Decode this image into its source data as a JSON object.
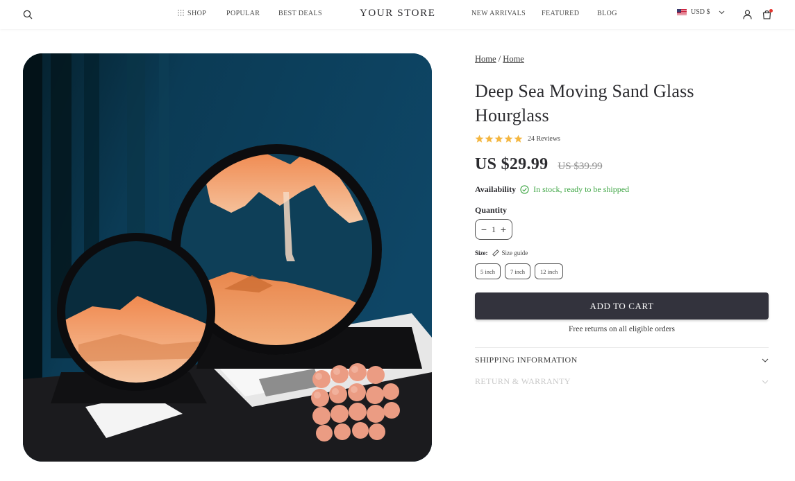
{
  "header": {
    "search_icon": "search-icon",
    "nav_left": [
      "SHOP",
      "POPULAR",
      "BEST DEALS"
    ],
    "logo": "YOUR STORE",
    "nav_right": [
      "NEW ARRIVALS",
      "FEATURED",
      "BLOG"
    ],
    "currency": "USD $",
    "account_icon": "user-icon",
    "cart_icon": "shopping-bag-icon"
  },
  "product": {
    "breadcrumb": [
      "Home",
      "Home"
    ],
    "breadcrumb_separator": "/",
    "title": "Deep Sea Moving Sand Glass Hourglass",
    "rating_stars": 5,
    "reviews": "24 Reviews",
    "price": "US $29.99",
    "compare_price": "US $39.99",
    "availability_label": "Availability",
    "availability_status": "In stock, ready to be shipped",
    "quantity_label": "Quantity",
    "quantity_value": "1",
    "size_label": "Size:",
    "size_guide": "Size guide",
    "sizes": [
      "5 inch",
      "7 inch",
      "12 inch"
    ],
    "add_to_cart": "ADD TO CART",
    "free_returns": "Free returns on all eligible orders",
    "accordions": [
      "SHIPPING INFORMATION",
      "RETURN & WARRANTY"
    ]
  },
  "colors": {
    "primary_button": "#33333d",
    "in_stock": "#3fa645",
    "star": "#f4b63f",
    "cart_badge": "#e5342c"
  }
}
